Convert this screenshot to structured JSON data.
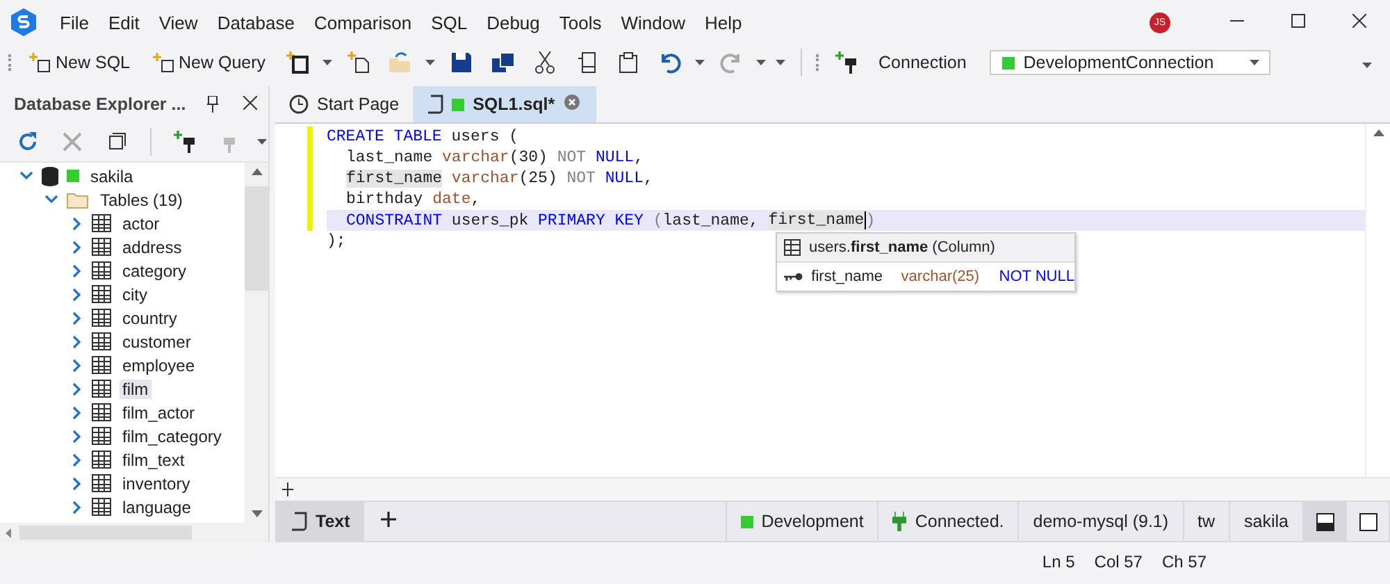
{
  "menu": [
    "File",
    "Edit",
    "View",
    "Database",
    "Comparison",
    "SQL",
    "Debug",
    "Tools",
    "Window",
    "Help"
  ],
  "user": {
    "initials": "JS"
  },
  "toolbar": {
    "buttons": [
      {
        "label": "New SQL"
      },
      {
        "label": "New Query"
      }
    ],
    "connection_label": "Connection",
    "connection": {
      "value": "DevelopmentConnection",
      "color": "#33cc33"
    }
  },
  "explorer": {
    "title": "Database Explorer ...",
    "tree": [
      {
        "label": "sakila",
        "kind": "database",
        "color": "#33cc33",
        "expanded": true,
        "selected": false,
        "children": [
          {
            "label": "Tables (19)",
            "kind": "folder",
            "expanded": true,
            "selected": false,
            "children": [
              {
                "label": "actor",
                "kind": "table",
                "expanded": false,
                "selected": false
              },
              {
                "label": "address",
                "kind": "table",
                "expanded": false,
                "selected": false
              },
              {
                "label": "category",
                "kind": "table",
                "expanded": false,
                "selected": false
              },
              {
                "label": "city",
                "kind": "table",
                "expanded": false,
                "selected": false
              },
              {
                "label": "country",
                "kind": "table",
                "expanded": false,
                "selected": false
              },
              {
                "label": "customer",
                "kind": "table",
                "expanded": false,
                "selected": false
              },
              {
                "label": "employee",
                "kind": "table",
                "expanded": false,
                "selected": false
              },
              {
                "label": "film",
                "kind": "table",
                "expanded": false,
                "selected": true
              },
              {
                "label": "film_actor",
                "kind": "table",
                "expanded": false,
                "selected": false
              },
              {
                "label": "film_category",
                "kind": "table",
                "expanded": false,
                "selected": false
              },
              {
                "label": "film_text",
                "kind": "table",
                "expanded": false,
                "selected": false
              },
              {
                "label": "inventory",
                "kind": "table",
                "expanded": false,
                "selected": false
              },
              {
                "label": "language",
                "kind": "table",
                "expanded": false,
                "selected": false
              }
            ]
          }
        ]
      }
    ]
  },
  "tabs": [
    {
      "label": "Start Page",
      "kind": "start",
      "selected": false
    },
    {
      "label": "SQL1.sql*",
      "kind": "sql",
      "color": "#33cc33",
      "selected": true
    }
  ],
  "editor": {
    "lines": [
      {
        "indented": false,
        "current": false,
        "tokens": [
          {
            "text": "CREATE TABLE",
            "kind": "keyword"
          },
          {
            "text": " users (",
            "kind": "plain"
          }
        ]
      },
      {
        "indented": true,
        "current": false,
        "tokens": [
          {
            "text": "last_name ",
            "kind": "plain"
          },
          {
            "text": "varchar",
            "kind": "type"
          },
          {
            "text": "(30) ",
            "kind": "plain"
          },
          {
            "text": "NOT ",
            "kind": "gray"
          },
          {
            "text": "NULL",
            "kind": "keyword"
          },
          {
            "text": ",",
            "kind": "plain"
          }
        ]
      },
      {
        "indented": true,
        "current": false,
        "tokens": [
          {
            "text": "first_name",
            "kind": "highlight"
          },
          {
            "text": " varchar",
            "kind": "type"
          },
          {
            "text": "(25) ",
            "kind": "plain"
          },
          {
            "text": "NOT ",
            "kind": "gray"
          },
          {
            "text": "NULL",
            "kind": "keyword"
          },
          {
            "text": ",",
            "kind": "plain"
          }
        ]
      },
      {
        "indented": true,
        "current": false,
        "tokens": [
          {
            "text": "birthday ",
            "kind": "plain"
          },
          {
            "text": "date",
            "kind": "type"
          },
          {
            "text": ",",
            "kind": "plain"
          }
        ]
      },
      {
        "indented": true,
        "current": true,
        "tokens": [
          {
            "text": "CONSTRAINT",
            "kind": "keyword"
          },
          {
            "text": " users_pk ",
            "kind": "plain"
          },
          {
            "text": "PRIMARY KEY ",
            "kind": "keyword"
          },
          {
            "text": "(",
            "kind": "gray"
          },
          {
            "text": "last_name, ",
            "kind": "plain"
          },
          {
            "text": "first_name",
            "kind": "highlight",
            "caret": true
          },
          {
            "text": ")",
            "kind": "gray"
          }
        ]
      },
      {
        "indented": false,
        "current": false,
        "tokens": [
          {
            "text": ");",
            "kind": "plain"
          }
        ]
      }
    ],
    "completion": {
      "header": "users.**first_name** (Column)",
      "name": "first_name",
      "type": "varchar(25)",
      "constraint": "NOT NULL"
    }
  },
  "bottom_tabs": [
    {
      "label": "Text",
      "selected": true
    }
  ],
  "status": [
    {
      "label": "Development",
      "kind": "color",
      "color": "#33cc33"
    },
    {
      "label": "Connected.",
      "kind": "plug"
    },
    {
      "label": "demo-mysql (9.1)",
      "kind": "text"
    },
    {
      "label": "tw",
      "kind": "text"
    },
    {
      "label": "sakila",
      "kind": "text"
    }
  ],
  "footer": [
    "Ln 5",
    "Col 57",
    "Ch 57"
  ]
}
